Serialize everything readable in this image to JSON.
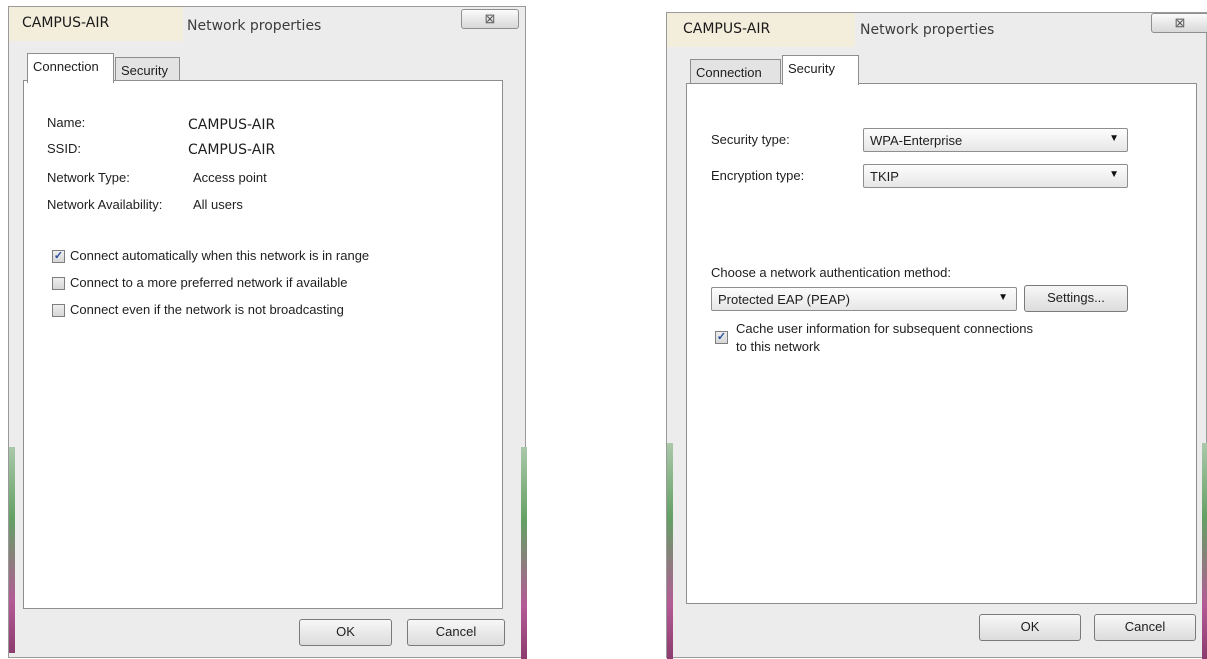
{
  "left_dialog": {
    "network_name": "CAMPUS-AIR",
    "title": "Network properties",
    "close_glyph": "⊠",
    "tabs": [
      {
        "label": "Connection",
        "active": true
      },
      {
        "label": "Security",
        "active": false
      }
    ],
    "fields": [
      {
        "label": "Name:",
        "value": "CAMPUS-AIR"
      },
      {
        "label": "SSID:",
        "value": "CAMPUS-AIR"
      },
      {
        "label": "Network Type:",
        "value": "Access point"
      },
      {
        "label": "Network Availability:",
        "value": "All users"
      }
    ],
    "checkboxes": [
      {
        "label": "Connect automatically when this network is in range",
        "checked": true
      },
      {
        "label": "Connect to a more preferred network if available",
        "checked": false
      },
      {
        "label": "Connect even if the network is not broadcasting",
        "checked": false
      }
    ],
    "ok_label": "OK",
    "cancel_label": "Cancel"
  },
  "right_dialog": {
    "network_name": "CAMPUS-AIR",
    "title": "Network properties",
    "close_glyph": "⊠",
    "tabs": [
      {
        "label": "Connection",
        "active": false
      },
      {
        "label": "Security",
        "active": true
      }
    ],
    "security_type_label": "Security type:",
    "security_type_value": "WPA-Enterprise",
    "encryption_type_label": "Encryption type:",
    "encryption_type_value": "TKIP",
    "auth_method_label": "Choose a network authentication method:",
    "auth_method_value": "Protected EAP (PEAP)",
    "settings_label": "Settings...",
    "cache_label_line1": "Cache user information for subsequent connections",
    "cache_label_line2": "to this network",
    "cache_checked": true,
    "ok_label": "OK",
    "cancel_label": "Cancel"
  },
  "icons": {
    "dropdown": "chevron-down-icon",
    "close": "close-icon",
    "check": "checkmark-icon"
  }
}
